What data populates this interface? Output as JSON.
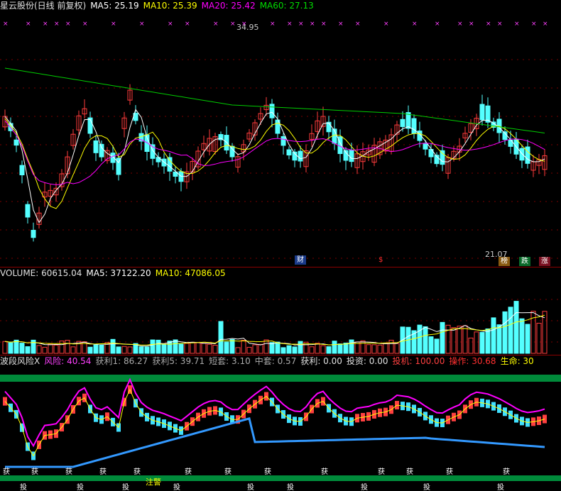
{
  "price_header": {
    "stock": "星云股份(日线 前复权)",
    "ma5": "MA5: 25.19",
    "ma10": "MA10: 25.39",
    "ma20": "MA20: 25.42",
    "ma60": "MA60: 27.13"
  },
  "price_high_label": "34.95",
  "price_low_label": "21.07",
  "event_tags": {
    "cai": "财",
    "s": "$",
    "bang": "榜",
    "die": "跌",
    "zhang": "涨"
  },
  "volume_header": {
    "volume": "VOLUME: 60615.04",
    "ma5": "MA5: 37122.20",
    "ma10": "MA10: 47086.05"
  },
  "indicator_header": {
    "name": "波段风险X",
    "risk": "风险: 40.54",
    "profit1": "获利1: 86.27",
    "profit5": "获利5: 39.71",
    "short_trap": "短套: 3.10",
    "mid_trap": "中套: 0.57",
    "gain": "获利: 0.00",
    "invest": "投资: 0.00",
    "speculate": "投机: 100.00",
    "operation": "操作: 30.68",
    "life": "生命: 30"
  },
  "indicator_markers": {
    "huo": "获",
    "tou": "投",
    "warn": "注警"
  },
  "colors": {
    "up": "#ff3c3c",
    "down": "#54ffff",
    "ma5": "#ffffff",
    "ma10": "#ffff00",
    "ma20": "#ff00ff",
    "ma60": "#00cc00",
    "risk": "#ff00ff",
    "band": "#008a3a"
  },
  "chart_data": [
    {
      "type": "candlestick",
      "title": "星云股份(日线 前复权)",
      "max": 34.95,
      "min": 21.07,
      "series": [
        {
          "name": "MA5",
          "last": 25.19
        },
        {
          "name": "MA10",
          "last": 25.39
        },
        {
          "name": "MA20",
          "last": 25.42
        },
        {
          "name": "MA60",
          "last": 27.13
        }
      ]
    },
    {
      "type": "bar",
      "title": "VOLUME",
      "series": [
        {
          "name": "VOLUME",
          "last": 60615.04
        },
        {
          "name": "MA5",
          "last": 37122.2
        },
        {
          "name": "MA10",
          "last": 47086.05
        }
      ]
    },
    {
      "type": "line",
      "title": "波段风险X",
      "series": [
        {
          "name": "风险",
          "last": 40.54
        },
        {
          "name": "获利1",
          "last": 86.27
        },
        {
          "name": "获利5",
          "last": 39.71
        },
        {
          "name": "短套",
          "last": 3.1
        },
        {
          "name": "中套",
          "last": 0.57
        },
        {
          "name": "获利",
          "last": 0.0
        },
        {
          "name": "投资",
          "last": 0.0
        },
        {
          "name": "投机",
          "last": 100.0
        },
        {
          "name": "操作",
          "last": 30.68
        },
        {
          "name": "生命",
          "last": 30
        }
      ]
    }
  ]
}
